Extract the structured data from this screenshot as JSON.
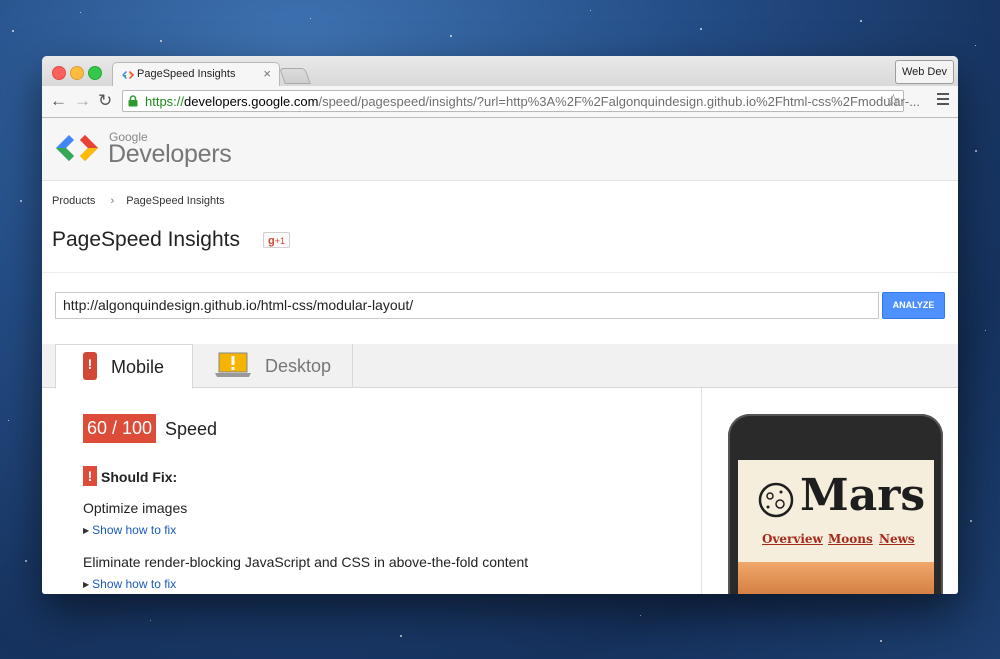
{
  "browser": {
    "tab_title": "PageSpeed Insights",
    "tab_close": "×",
    "right_button": "Web Dev",
    "url_scheme": "https://",
    "url_host": "developers.google.com",
    "url_path": "/speed/pagespeed/insights/?url=http%3A%2F%2Falgonquindesign.github.io%2Fhtml-css%2Fmodular-..."
  },
  "header": {
    "logo_small": "Google",
    "logo_big": "Developers"
  },
  "breadcrumb": {
    "items": [
      "Products",
      "PageSpeed Insights"
    ],
    "separator": "›"
  },
  "page": {
    "title": "PageSpeed Insights",
    "gplus": "+1"
  },
  "form": {
    "url_value": "http://algonquindesign.github.io/html-css/modular-layout/",
    "analyze_label": "ANALYZE"
  },
  "tabs": [
    {
      "label": "Mobile",
      "active": true
    },
    {
      "label": "Desktop",
      "active": false
    }
  ],
  "results": {
    "score": "60 / 100",
    "score_label": "Speed",
    "section_title": "Should Fix:",
    "rules": [
      {
        "title": "Optimize images",
        "link": "Show how to fix"
      },
      {
        "title": "Eliminate render-blocking JavaScript and CSS in above-the-fold content",
        "link": "Show how to fix"
      }
    ]
  },
  "preview": {
    "site_title": "Mars",
    "nav": [
      "Overview",
      "Moons",
      "News"
    ]
  },
  "colors": {
    "score_red": "#dd4b39",
    "analyze_blue": "#4d90fe",
    "link_blue": "#1a5bb8",
    "secure_green": "#1c8d1c"
  },
  "icons": [
    "back-arrow-icon",
    "forward-arrow-icon",
    "reload-icon",
    "lock-icon",
    "bookmark-star-icon",
    "menu-icon",
    "mobile-phone-icon",
    "laptop-icon",
    "warning-icon"
  ]
}
